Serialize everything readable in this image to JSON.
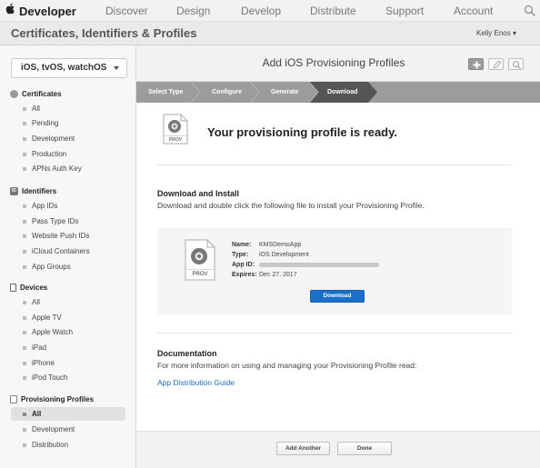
{
  "topnav": {
    "brand": "Developer",
    "items": [
      "Discover",
      "Design",
      "Develop",
      "Distribute",
      "Support",
      "Account"
    ]
  },
  "subheader": {
    "title": "Certificates, Identifiers & Profiles",
    "user": "Kelly Enos ▾"
  },
  "sidebar": {
    "platform": "iOS, tvOS, watchOS",
    "sections": [
      {
        "title": "Certificates",
        "icon": "certificate-icon",
        "items": [
          "All",
          "Pending",
          "Development",
          "Production",
          "APNs Auth Key"
        ]
      },
      {
        "title": "Identifiers",
        "icon": "id-icon",
        "items": [
          "App IDs",
          "Pass Type IDs",
          "Website Push IDs",
          "iCloud Containers",
          "App Groups"
        ]
      },
      {
        "title": "Devices",
        "icon": "device-icon",
        "items": [
          "All",
          "Apple TV",
          "Apple Watch",
          "iPad",
          "iPhone",
          "iPod Touch"
        ]
      },
      {
        "title": "Provisioning Profiles",
        "icon": "profile-icon",
        "items": [
          "All",
          "Development",
          "Distribution"
        ],
        "active": "All"
      }
    ]
  },
  "main": {
    "title": "Add iOS Provisioning Profiles",
    "steps": [
      "Select Type",
      "Configure",
      "Generate",
      "Download"
    ],
    "current_step": "Download",
    "icon_label": "PROV",
    "ready": "Your provisioning profile is ready.",
    "download": {
      "heading": "Download and Install",
      "text": "Download and double click the following file to install your Provisioning Profile.",
      "name_label": "Name:",
      "name": "KMSDemoApp",
      "type_label": "Type:",
      "type": "iOS Development",
      "appid_label": "App ID:",
      "expires_label": "Expires:",
      "expires": "Dec 27, 2017",
      "button": "Download"
    },
    "documentation": {
      "heading": "Documentation",
      "text": "For more information on using and managing your Provisioning Profile read:",
      "link": "App Distribution Guide"
    }
  },
  "footer": {
    "add_another": "Add Another",
    "done": "Done"
  },
  "colors": {
    "accent": "#1a6fc9",
    "steps_bg": "#9c9c9c",
    "active_step": "#555555"
  }
}
